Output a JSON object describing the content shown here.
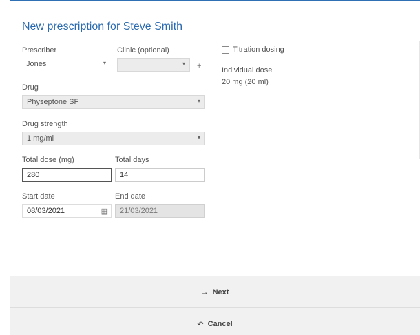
{
  "title": "New prescription for Steve Smith",
  "prescriber": {
    "label": "Prescriber",
    "value": "Jones"
  },
  "clinic": {
    "label": "Clinic (optional)",
    "value": ""
  },
  "plus_symbol": "+",
  "titration": {
    "label": "Titration dosing",
    "checked": false
  },
  "individual_dose": {
    "label": "Individual dose",
    "value": "20 mg (20 ml)"
  },
  "drug": {
    "label": "Drug",
    "value": "Physeptone SF"
  },
  "drug_strength": {
    "label": "Drug strength",
    "value": "1 mg/ml"
  },
  "total_dose": {
    "label": "Total dose (mg)",
    "value": "280"
  },
  "total_days": {
    "label": "Total days",
    "value": "14"
  },
  "start_date": {
    "label": "Start date",
    "value": "08/03/2021"
  },
  "end_date": {
    "label": "End date",
    "value": "21/03/2021"
  },
  "icons": {
    "dropdown": "▾",
    "calendar": "▦",
    "next": "→",
    "cancel": "↶"
  },
  "buttons": {
    "next": "Next",
    "cancel": "Cancel"
  },
  "colors": {
    "accent": "#2a6ab0",
    "footer_bg": "#f1f1f1",
    "disabled_bg": "#e4e4e4"
  }
}
